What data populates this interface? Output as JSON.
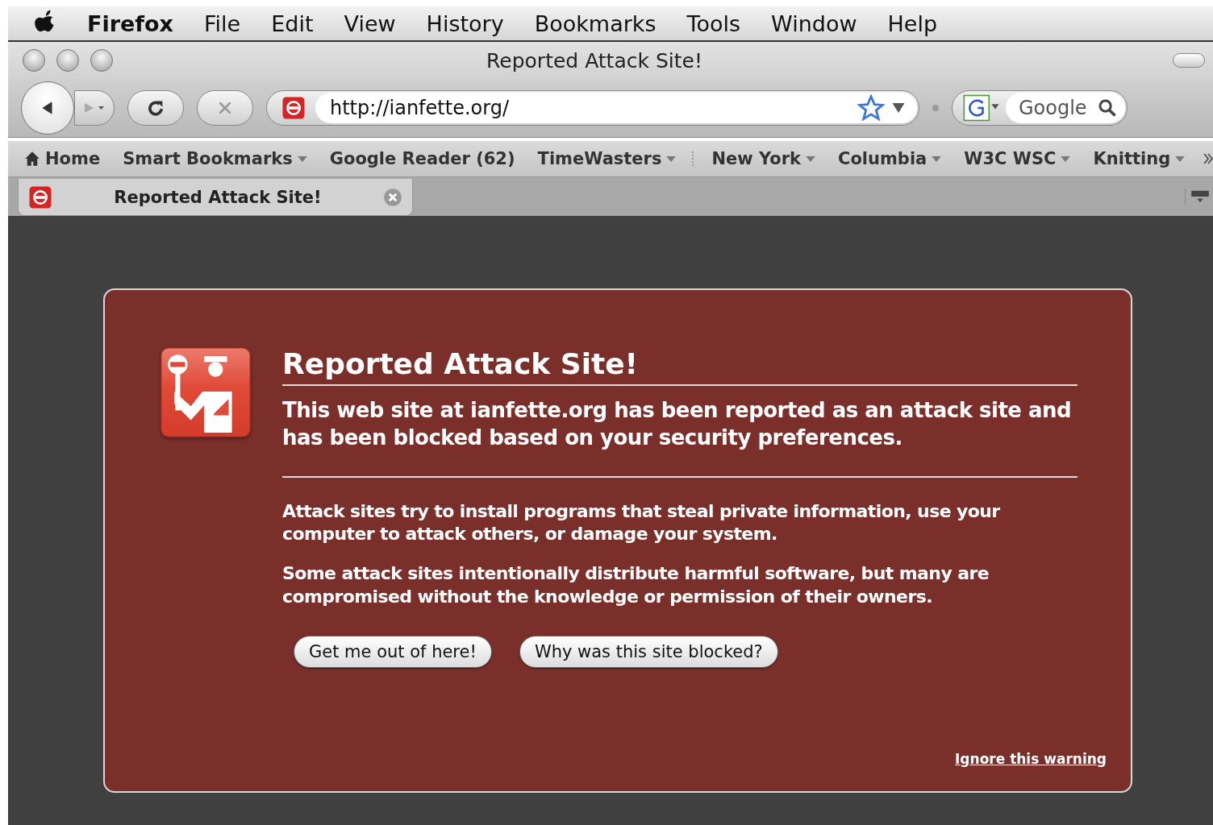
{
  "menu_bar": {
    "app": "Firefox",
    "items": [
      "File",
      "Edit",
      "View",
      "History",
      "Bookmarks",
      "Tools",
      "Window",
      "Help"
    ]
  },
  "window": {
    "title": "Reported Attack Site!"
  },
  "toolbar": {
    "url": "http://ianfette.org/",
    "search_placeholder": "Google"
  },
  "bookmarks": [
    {
      "label": "Home",
      "kind": "home"
    },
    {
      "label": "Smart Bookmarks",
      "kind": "folder"
    },
    {
      "label": "Google Reader (62)",
      "kind": "link"
    },
    {
      "label": "TimeWasters",
      "kind": "folder"
    },
    {
      "kind": "separator"
    },
    {
      "label": "New York",
      "kind": "folder"
    },
    {
      "label": "Columbia",
      "kind": "folder"
    },
    {
      "label": "W3C WSC",
      "kind": "folder"
    },
    {
      "label": "Knitting",
      "kind": "folder"
    }
  ],
  "tabs": [
    {
      "label": "Reported Attack Site!",
      "selected": true
    }
  ],
  "warning": {
    "title": "Reported Attack Site!",
    "summary": "This web site at ianfette.org has been reported as an attack site and has been blocked based on your security preferences.",
    "paragraphs": [
      "Attack sites try to install programs that steal private information, use your computer to attack others, or damage your system.",
      "Some attack sites intentionally distribute harmful software, but many are compromised without the knowledge or permission of their owners."
    ],
    "buttons": [
      "Get me out of here!",
      "Why was this site blocked?"
    ],
    "ignore_link": "Ignore this warning"
  }
}
